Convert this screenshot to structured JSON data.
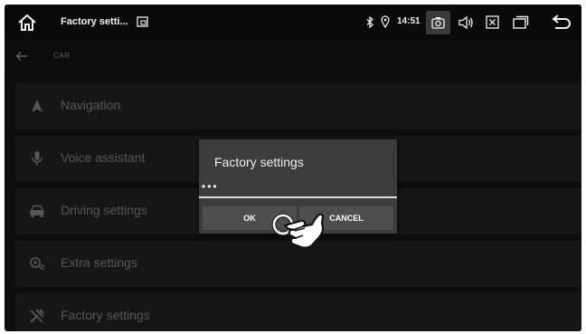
{
  "status_bar": {
    "title": "Factory setti...",
    "time": "14:51",
    "icons": [
      "home-icon",
      "window-icon",
      "bluetooth-icon",
      "location-icon",
      "camera-icon",
      "volume-icon",
      "close-box-icon",
      "recent-apps-icon",
      "back-icon"
    ]
  },
  "header": {
    "title": "CAR"
  },
  "menu": {
    "items": [
      {
        "label": "Navigation",
        "icon": "navigation-arrow-icon"
      },
      {
        "label": "Voice assistant",
        "icon": "microphone-icon"
      },
      {
        "label": "Driving settings",
        "icon": "car-icon"
      },
      {
        "label": "Extra settings",
        "icon": "extra-settings-icon"
      },
      {
        "label": "Factory settings",
        "icon": "wrench-icon"
      }
    ]
  },
  "dialog": {
    "title": "Factory settings",
    "input_value": "•••",
    "ok_label": "OK",
    "cancel_label": "CANCEL"
  },
  "colors": {
    "screen_background": "#141414",
    "list_item_background": "#202020",
    "dialog_background": "#3c3c3c",
    "dialog_button": "#4e4e4e"
  }
}
